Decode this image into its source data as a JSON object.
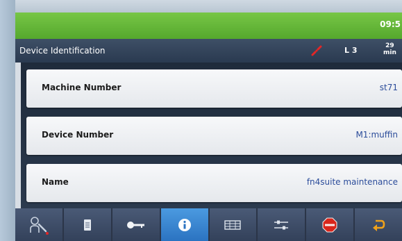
{
  "status": {
    "clock": "09:5"
  },
  "header": {
    "title": "Device Identification",
    "level": "L 3",
    "timer_value": "29",
    "timer_unit": "min"
  },
  "fields": [
    {
      "label": "Machine Number",
      "value": "st71"
    },
    {
      "label": "Device Number",
      "value": "M1:muffin"
    },
    {
      "label": "Name",
      "value": "fn4suite maintenance"
    }
  ],
  "toolbar": {
    "buttons": [
      {
        "icon": "service-tools-icon"
      },
      {
        "icon": "document-icon"
      },
      {
        "icon": "key-icon"
      },
      {
        "icon": "info-icon",
        "active": true
      },
      {
        "icon": "grid-table-icon"
      },
      {
        "icon": "sliders-icon"
      },
      {
        "icon": "stop-icon",
        "text": "STOP"
      },
      {
        "icon": "back-arrow-icon"
      }
    ]
  },
  "colors": {
    "status_green": "#5fb335",
    "header_bg": "#2f3f56",
    "value_blue": "#2b4c9a",
    "active_button": "#3b86d0",
    "back_arrow": "#f0a21a",
    "stop_red": "#d9261c"
  }
}
